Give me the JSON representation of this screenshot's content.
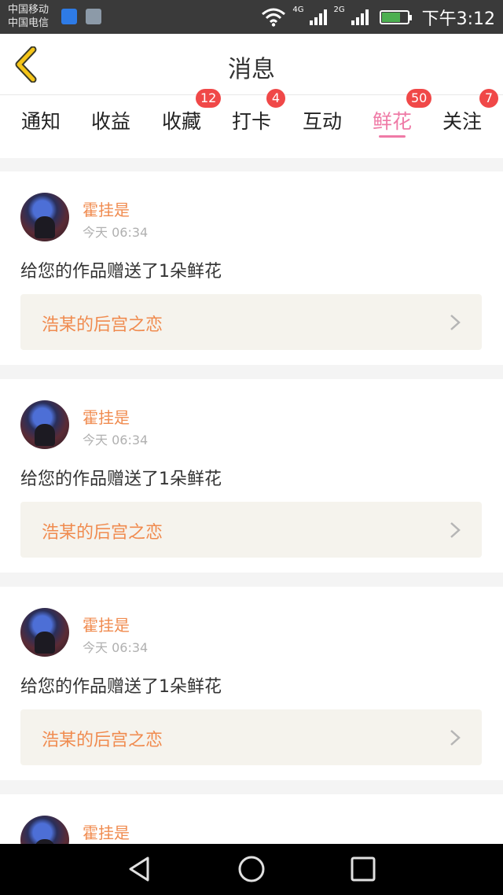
{
  "status_bar": {
    "carrier_1": "中国移动",
    "carrier_2": "中国电信",
    "network_1": "4G",
    "network_2": "2G",
    "time": "下午3:12"
  },
  "header": {
    "title": "消息",
    "back_icon": "chevron-left-icon",
    "accent_color": "#f5c518"
  },
  "tabs": [
    {
      "label": "通知",
      "badge": ""
    },
    {
      "label": "收益",
      "badge": ""
    },
    {
      "label": "收藏",
      "badge": "12"
    },
    {
      "label": "打卡",
      "badge": "4"
    },
    {
      "label": "互动",
      "badge": ""
    },
    {
      "label": "鲜花",
      "badge": "50",
      "active": true
    },
    {
      "label": "关注",
      "badge": "7"
    }
  ],
  "active_tab_color": "#ef7aa6",
  "messages": [
    {
      "user": "霍挂是",
      "time": "今天 06:34",
      "text": "给您的作品赠送了1朵鲜花",
      "work": "浩某的后宫之恋"
    },
    {
      "user": "霍挂是",
      "time": "今天 06:34",
      "text": "给您的作品赠送了1朵鲜花",
      "work": "浩某的后宫之恋"
    },
    {
      "user": "霍挂是",
      "time": "今天 06:34",
      "text": "给您的作品赠送了1朵鲜花",
      "work": "浩某的后宫之恋"
    },
    {
      "user": "霍挂是",
      "time": "",
      "text": "",
      "work": ""
    }
  ],
  "navbar": {
    "back_icon": "triangle-back-icon",
    "home_icon": "circle-home-icon",
    "recents_icon": "square-recents-icon"
  }
}
